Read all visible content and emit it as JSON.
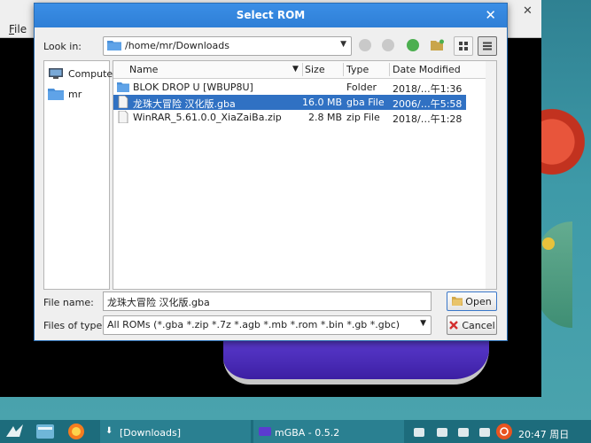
{
  "dialog": {
    "title": "Select ROM",
    "look_in_label": "Look in:",
    "path": "/home/mr/Downloads",
    "file_name_label": "File name:",
    "file_name_value": "龙珠大冒险 汉化版.gba",
    "files_of_type_label": "Files of type:",
    "files_of_type_value": "All ROMs (*.gba *.zip *.7z *.agb *.mb *.rom *.bin *.gb *.gbc)",
    "open_label": "Open",
    "cancel_label": "Cancel"
  },
  "sidebar": {
    "items": [
      {
        "label": "Computer",
        "icon": "computer-icon"
      },
      {
        "label": "mr",
        "icon": "folder-icon"
      }
    ]
  },
  "filelist": {
    "columns": [
      "Name",
      "Size",
      "Type",
      "Date Modified"
    ],
    "rows": [
      {
        "name": "BLOK DROP U [WBUP8U]",
        "size": "",
        "type": "Folder",
        "date": "2018/…午1:36",
        "icon": "folder-icon"
      },
      {
        "name": "龙珠大冒险 汉化版.gba",
        "size": "16.0 MB",
        "type": "gba File",
        "date": "2006/…午5:58",
        "icon": "file-icon"
      },
      {
        "name": "WinRAR_5.61.0.0_XiaZaiBa.zip",
        "size": "2.8 MB",
        "type": "zip File",
        "date": "2018/…午1:28",
        "icon": "file-icon"
      }
    ]
  },
  "mgba": {
    "menu_file": "File"
  },
  "taskbar": {
    "downloads": "[Downloads]",
    "mgba": "mGBA - 0.5.2",
    "clock": "20:47 周日"
  },
  "colors": {
    "titlebar": "#2f7fd6",
    "selection": "#3071c3",
    "taskbar": "#1d6c7c"
  }
}
